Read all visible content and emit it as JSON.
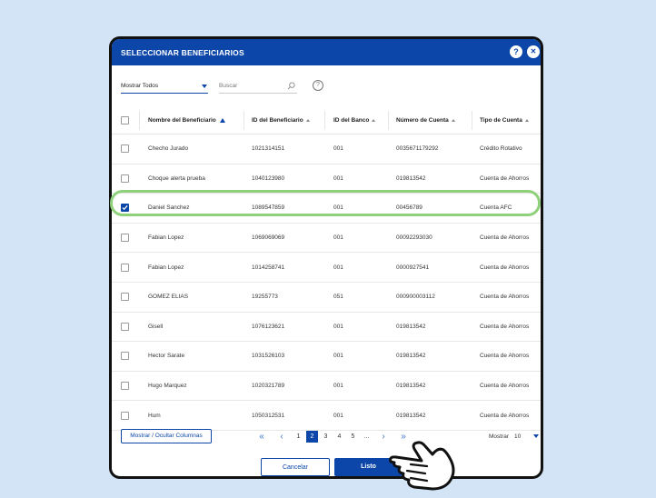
{
  "dialog": {
    "title": "SELECCIONAR BENEFICIARIOS",
    "help_glyph": "?",
    "close_glyph": "✕"
  },
  "toolbar": {
    "filter_value": "Mostrar Todos",
    "search_placeholder": "Buscar",
    "help_glyph": "?"
  },
  "table": {
    "columns": [
      "Nombre del Beneficiario",
      "ID del Beneficiario",
      "ID del Banco",
      "Número de Cuenta",
      "Tipo de Cuenta"
    ],
    "rows": [
      {
        "name": "Checho Jurado",
        "id": "1021314151",
        "bank": "001",
        "account": "0035671179292",
        "type": "Crédito Rotativo",
        "checked": false
      },
      {
        "name": "Choque alerta prueba",
        "id": "1040123980",
        "bank": "001",
        "account": "019813542",
        "type": "Cuenta de Ahorros",
        "checked": false
      },
      {
        "name": "Daniel Sanchez",
        "id": "1089547859",
        "bank": "001",
        "account": "00456789",
        "type": "Cuenta AFC",
        "checked": true
      },
      {
        "name": "Fabian Lopez",
        "id": "1069069069",
        "bank": "001",
        "account": "00092293030",
        "type": "Cuenta de Ahorros",
        "checked": false
      },
      {
        "name": "Fabian Lopez",
        "id": "1014258741",
        "bank": "001",
        "account": "0000927541",
        "type": "Cuenta de Ahorros",
        "checked": false
      },
      {
        "name": "GOMEZ ELIAS",
        "id": "19255773",
        "bank": "051",
        "account": "000900003112",
        "type": "Cuenta de Ahorros",
        "checked": false
      },
      {
        "name": "Gisell",
        "id": "1076123621",
        "bank": "001",
        "account": "019813542",
        "type": "Cuenta de Ahorros",
        "checked": false
      },
      {
        "name": "Hector Sarate",
        "id": "1031526103",
        "bank": "001",
        "account": "019813542",
        "type": "Cuenta de Ahorros",
        "checked": false
      },
      {
        "name": "Hugo Marquez",
        "id": "1020321789",
        "bank": "001",
        "account": "019813542",
        "type": "Cuenta de Ahorros",
        "checked": false
      },
      {
        "name": "Hum",
        "id": "1050312531",
        "bank": "001",
        "account": "019813542",
        "type": "Cuenta de Ahorros",
        "checked": false
      }
    ]
  },
  "footer": {
    "columns_button": "Mostrar / Ocultar Columnas",
    "pages": [
      "1",
      "2",
      "3",
      "4",
      "5",
      "..."
    ],
    "current_page": "2",
    "first_glyph": "«",
    "prev_glyph": "‹",
    "next_glyph": "›",
    "last_glyph": "»",
    "show_label": "Mostrar",
    "show_value": "10"
  },
  "actions": {
    "cancel_label": "Cancelar",
    "ok_label": "Listo"
  },
  "colors": {
    "primary": "#0b46a8",
    "highlight": "#8fd07a",
    "background": "#d3e4f7"
  }
}
